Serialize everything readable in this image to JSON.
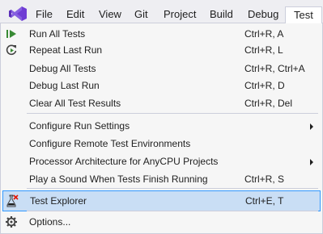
{
  "colors": {
    "menubar_bg": "#eeeef2",
    "dropdown_bg": "#f6f6f6",
    "highlight_bg": "#c9def5",
    "highlight_border": "#3399ff",
    "logo": "#6f3cd4",
    "run_icon": "#388a34"
  },
  "menubar": {
    "logo_icon": "visual-studio-logo",
    "items": [
      "File",
      "Edit",
      "View",
      "Git",
      "Project",
      "Build",
      "Debug",
      "Test"
    ],
    "active": "Test"
  },
  "test_menu": {
    "items": [
      {
        "label": "Run All Tests",
        "shortcut": "Ctrl+R, A",
        "icon": "run-all-tests-icon"
      },
      {
        "label": "Repeat Last Run",
        "shortcut": "Ctrl+R, L",
        "icon": "repeat-last-run-icon"
      },
      {
        "label": "Debug All Tests",
        "shortcut": "Ctrl+R, Ctrl+A"
      },
      {
        "label": "Debug Last Run",
        "shortcut": "Ctrl+R, D"
      },
      {
        "label": "Clear All Test Results",
        "shortcut": "Ctrl+R, Del"
      },
      {
        "label": "Configure Run Settings",
        "submenu": true
      },
      {
        "label": "Configure Remote Test Environments"
      },
      {
        "label": "Processor Architecture for AnyCPU Projects",
        "submenu": true
      },
      {
        "label": "Play a Sound When Tests Finish Running",
        "shortcut": "Ctrl+R, S"
      },
      {
        "label": "Test Explorer",
        "shortcut": "Ctrl+E, T",
        "icon": "test-explorer-icon",
        "highlighted": true
      },
      {
        "label": "Options...",
        "icon": "gear-icon"
      }
    ]
  }
}
